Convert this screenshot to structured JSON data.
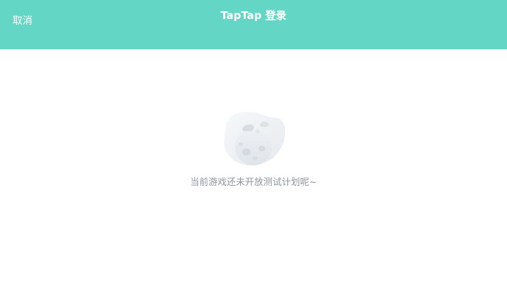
{
  "header": {
    "cancel_label": "取消",
    "title": "TapTap 登录",
    "background_color": "#64d6c6"
  },
  "main": {
    "empty_icon": "moon-planet-illustration",
    "empty_message": "当前游戏还未开放测试计划呢~"
  }
}
